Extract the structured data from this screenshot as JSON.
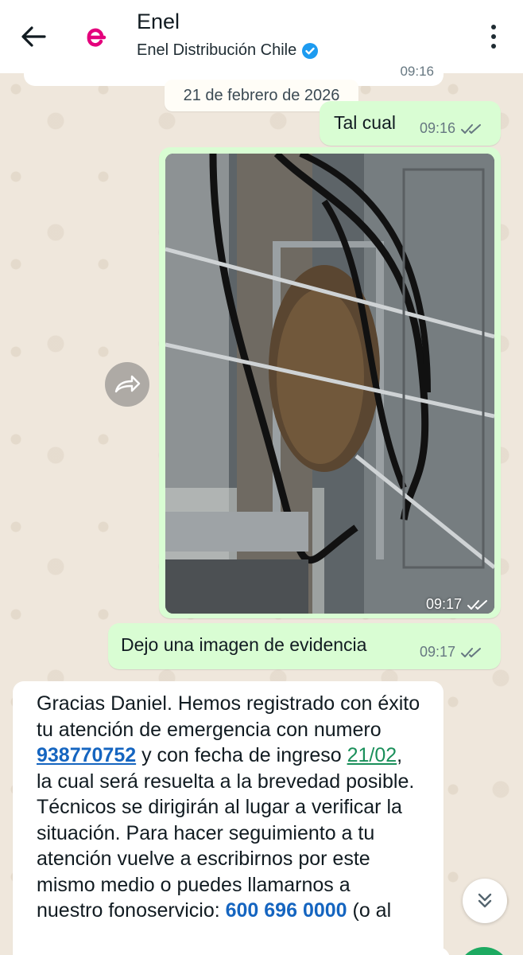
{
  "header": {
    "title": "Enel",
    "subtitle": "Enel Distribución Chile",
    "verified_icon": "verified-badge-icon",
    "brand_color": "#e4007c"
  },
  "chat": {
    "previous_time": "09:16",
    "date_chip": "21 de febrero de 2026",
    "messages": [
      {
        "text": "Tal cual",
        "time": "09:16",
        "status": "read"
      },
      {
        "type": "image",
        "time": "09:17",
        "status": "read"
      },
      {
        "text": "Dejo una imagen de evidencia",
        "time": "09:17",
        "status": "read"
      }
    ],
    "incoming": {
      "part1": "Gracias Daniel. Hemos registrado con éxito tu atención de emergencia con numero ",
      "ticket": "938770752",
      "part2": " y con fecha de ingreso ",
      "date": "21/02",
      "part3": ", la cual será resuelta a la brevedad posible. Técnicos se dirigirán al lugar a verificar la situación. Para hacer seguimiento a tu atención vuelve a escribirnos por este mismo medio o puedes llamarnos a nuestro fonoservicio: ",
      "phone": "600 696 0000",
      "part4": " (o al"
    }
  },
  "colors": {
    "outgoing_bubble": "#d9fdd3",
    "incoming_bubble": "#ffffff",
    "wallpaper": "#efe7dc",
    "link_blue": "#1565c0",
    "link_green": "#1a8f5a"
  }
}
